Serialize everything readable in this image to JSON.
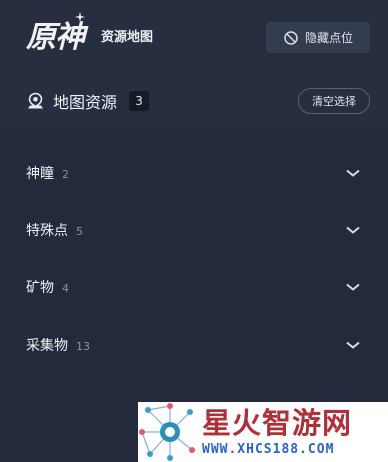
{
  "header": {
    "logo_text": "原神",
    "app_title": "资源地图",
    "hide_button_label": "隐藏点位",
    "hide_icon": "eye-off-icon"
  },
  "resources": {
    "title": "地图资源",
    "selected_count": "3",
    "clear_label": "清空选择",
    "icon": "map-pin-icon"
  },
  "categories": [
    {
      "name": "神瞳",
      "count": "2"
    },
    {
      "name": "特殊点",
      "count": "5"
    },
    {
      "name": "矿物",
      "count": "4"
    },
    {
      "name": "采集物",
      "count": "13"
    }
  ],
  "watermark": {
    "title": "星火智游网",
    "url": "WWW.XHCS188.COM"
  },
  "colors": {
    "background": "#222a3b",
    "header_background": "#262e40",
    "watermark_title": "#b0303a",
    "watermark_url": "#2a63c7"
  }
}
